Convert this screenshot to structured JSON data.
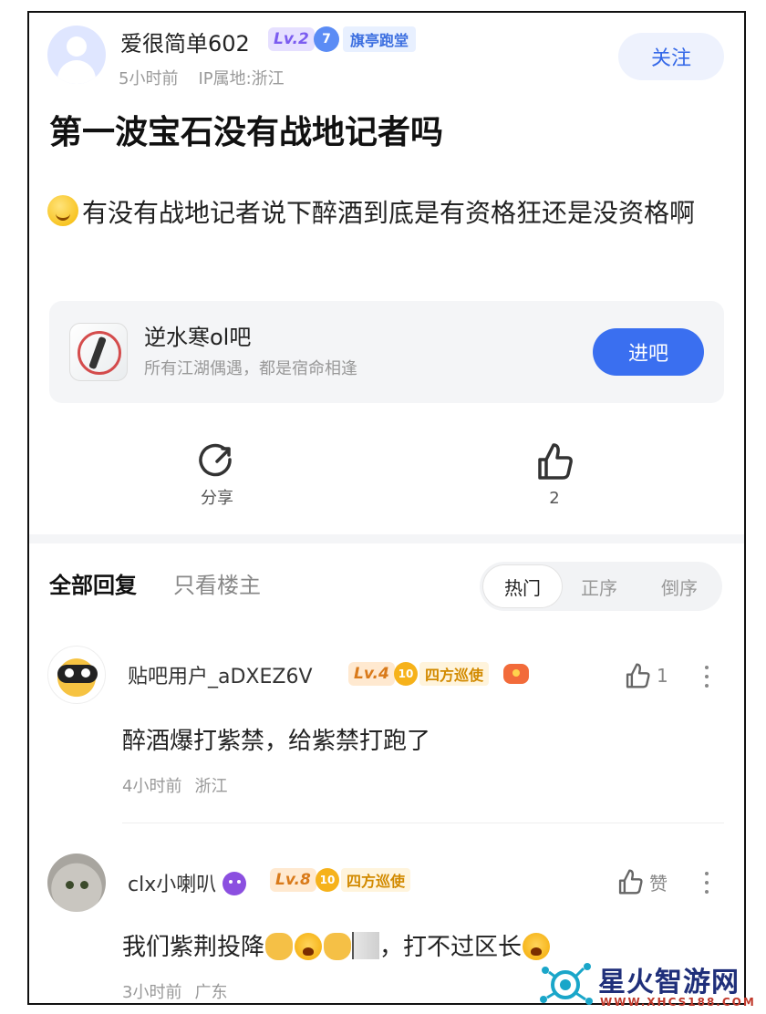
{
  "post": {
    "author": "爱很简单602",
    "level": "Lv.2",
    "tag_number": "7",
    "tag_text": "旗亭跑堂",
    "time": "5小时前",
    "ip": "IP属地:浙江",
    "follow_label": "关注",
    "title": "第一波宝石没有战地记者吗",
    "content": "有没有战地记者说下醉酒到底是有资格狂还是没资格啊"
  },
  "forum": {
    "name": "逆水寒ol吧",
    "desc": "所有江湖偶遇，都是宿命相逢",
    "enter_label": "进吧"
  },
  "actions": {
    "share_label": "分享",
    "like_count": "2"
  },
  "reply_tabs": {
    "all": "全部回复",
    "op_only": "只看楼主",
    "sort_hot": "热门",
    "sort_asc": "正序",
    "sort_desc": "倒序"
  },
  "comments": [
    {
      "user": "贴吧用户_aDXEZ6V",
      "level": "Lv.4",
      "honor_number": "10",
      "honor_text": "四方巡使",
      "like_count": "1",
      "text": "醉酒爆打紫禁，给紫禁打跑了",
      "time": "4小时前",
      "location": "浙江"
    },
    {
      "user": "clx小喇叭",
      "level": "Lv.8",
      "honor_number": "10",
      "honor_text": "四方巡使",
      "like_label": "赞",
      "text_a": "我们紫荆投降",
      "text_b": "，打不过区长",
      "time": "3小时前",
      "location": "广东"
    }
  ],
  "watermark": {
    "title": "星火智游网",
    "url": "WWW.XHCS188.COM"
  },
  "colors": {
    "accent": "#3a6ff0",
    "follow_bg": "#eef2fd",
    "level_purple": "#7b5cf0",
    "level_orange": "#d97a1a"
  }
}
